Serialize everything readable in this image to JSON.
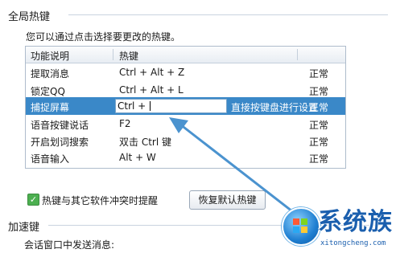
{
  "global_section": {
    "title": "全局热键",
    "instruction": "您可以通过点击选择要更改的热键。"
  },
  "table": {
    "headers": [
      "功能说明",
      "热键"
    ],
    "rows": [
      {
        "func": "提取消息",
        "hotkey": "Ctrl + Alt + Z",
        "status": "正常"
      },
      {
        "func": "锁定QQ",
        "hotkey": "Ctrl + Alt + L",
        "status": "正常"
      },
      {
        "func": "捕捉屏幕",
        "hotkey": "Ctrl + ",
        "status": "正常",
        "hint": "直接按键盘进行设置"
      },
      {
        "func": "语音按键说话",
        "hotkey": "F2",
        "status": "正常"
      },
      {
        "func": "开启划词搜索",
        "hotkey": "双击 Ctrl 键",
        "status": "正常"
      },
      {
        "func": "语音输入",
        "hotkey": "Alt + W",
        "status": "正常"
      }
    ]
  },
  "conflict_checkbox": {
    "label": "热键与其它软件冲突时提醒",
    "checked": true
  },
  "restore_button": {
    "label": "恢复默认热键"
  },
  "accel_section": {
    "title": "加速键",
    "sub_label": "会话窗口中发送消息:"
  },
  "watermark": {
    "title": "系统族",
    "url": "xitongcheng.com"
  },
  "colors": {
    "selection": "#3a88c8",
    "arrow": "#4b93cf",
    "checkbox": "#4caf50"
  }
}
